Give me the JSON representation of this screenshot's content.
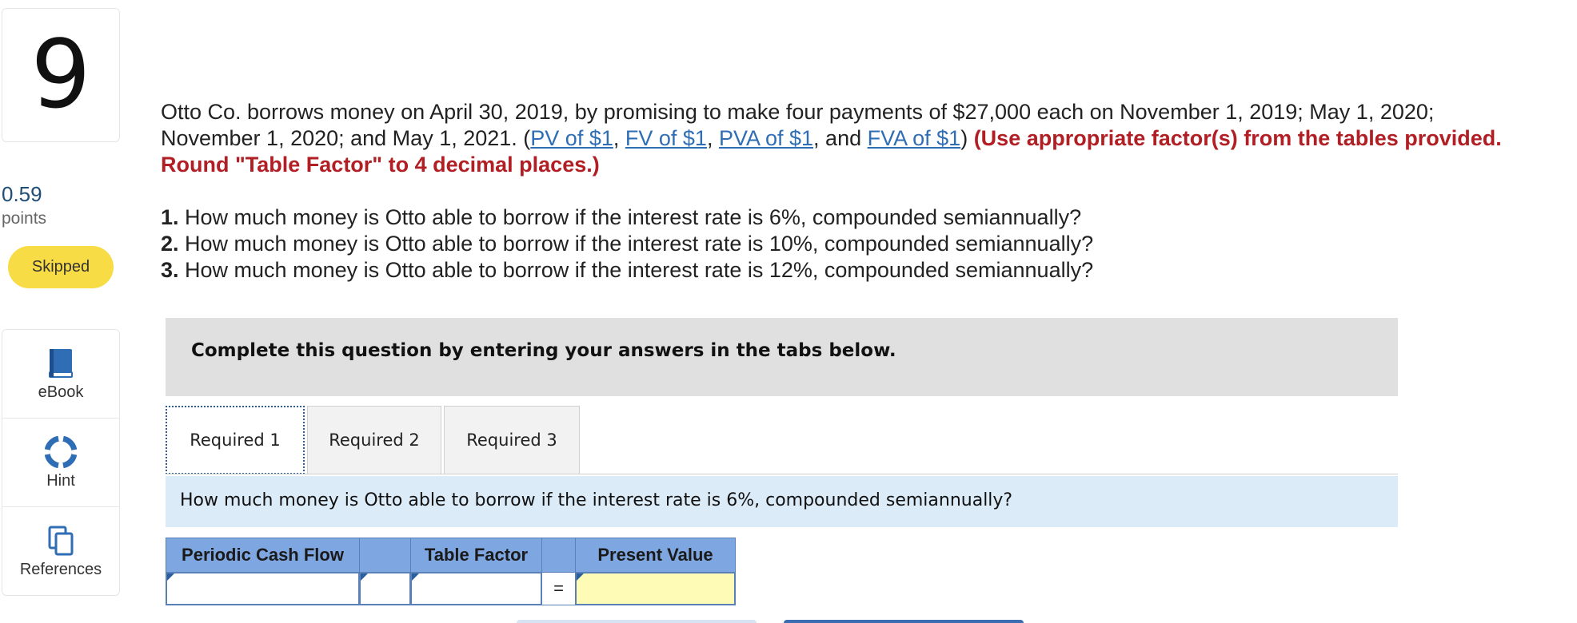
{
  "question": {
    "number": "9",
    "points": "0.59",
    "points_label": "points",
    "status": "Skipped",
    "intro": "Otto Co. borrows money on April 30, 2019, by promising to make four payments of $27,000 each on November 1, 2019; May 1, 2020; November 1, 2020; and May 1, 2021. (",
    "links": [
      "PV of $1",
      "FV of $1",
      "PVA of $1",
      "FVA of $1"
    ],
    "sep_comma": ", ",
    "sep_and": ", and ",
    "close_paren": ") ",
    "instruction": "(Use appropriate factor(s) from the tables provided. Round \"Table Factor\" to 4 decimal places.)",
    "items": [
      {
        "num": "1.",
        "text": " How much money is Otto able to borrow if the interest rate is 6%, compounded semiannually?"
      },
      {
        "num": "2.",
        "text": " How much money is Otto able to borrow if the interest rate is 10%, compounded semiannually?"
      },
      {
        "num": "3.",
        "text": " How much money is Otto able to borrow if the interest rate is 12%, compounded semiannually?"
      }
    ]
  },
  "tools": [
    {
      "label": "eBook",
      "icon": "book-icon"
    },
    {
      "label": "Hint",
      "icon": "lifebuoy-icon"
    },
    {
      "label": "References",
      "icon": "copy-icon"
    }
  ],
  "banner": "Complete this question by entering your answers in the tabs below.",
  "tabs": [
    "Required 1",
    "Required 2",
    "Required 3"
  ],
  "active_tab": "Required 1",
  "subquestion": "How much money is Otto able to borrow if the interest rate is 6%, compounded semiannually?",
  "table": {
    "headers": [
      "Periodic Cash Flow",
      "",
      "Table Factor",
      "",
      "Present Value"
    ],
    "equals": "="
  },
  "colors": {
    "link": "#2f6eb5",
    "warning": "#b11f24",
    "skipped_badge": "#f8dc45",
    "table_header": "#7ea6e0",
    "answer_cell": "#fdfbb5"
  }
}
